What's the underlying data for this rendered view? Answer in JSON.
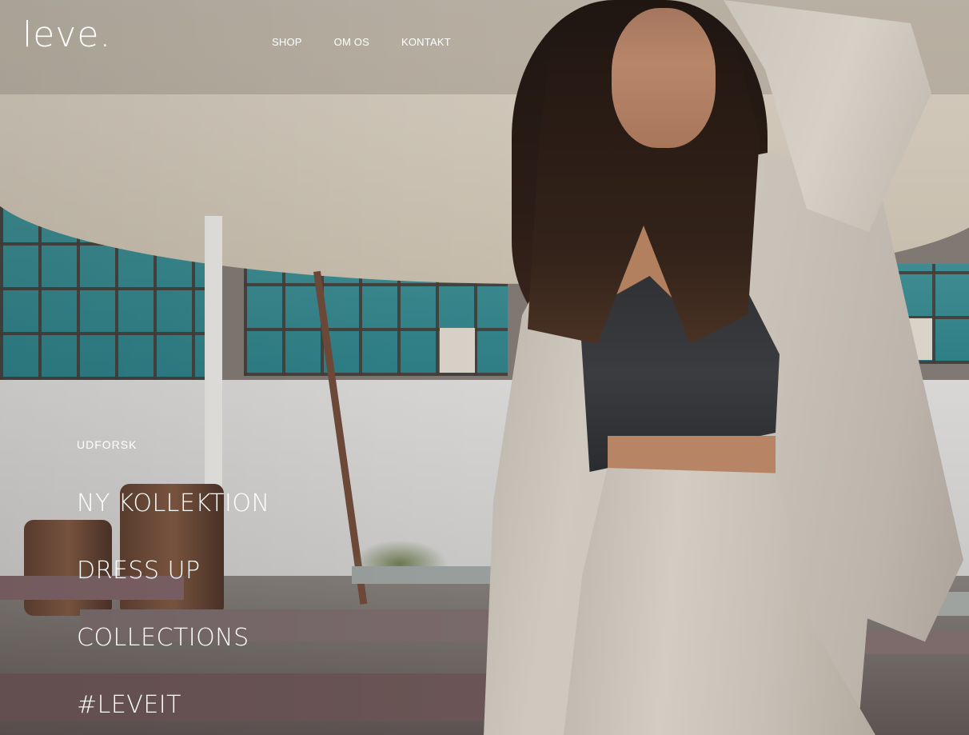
{
  "header": {
    "logo": "leve.",
    "nav": [
      {
        "label": "SHOP"
      },
      {
        "label": "OM OS"
      },
      {
        "label": "KONTAKT"
      }
    ]
  },
  "hero": {
    "explore_label": "UDFORSK",
    "links": [
      {
        "label": "NY KOLLEKTION"
      },
      {
        "label": "DRESS UP"
      },
      {
        "label": "COLLECTIONS"
      },
      {
        "label": "#LEVEIT"
      }
    ]
  },
  "colors": {
    "overlay_text": "#ffffff"
  }
}
